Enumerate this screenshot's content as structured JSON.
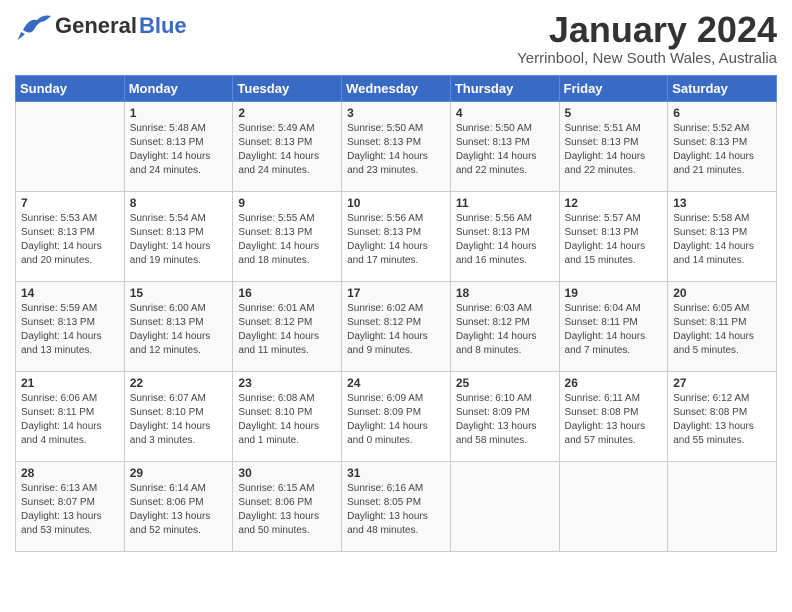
{
  "logo": {
    "text_general": "General",
    "text_blue": "Blue"
  },
  "title": "January 2024",
  "location": "Yerrinbool, New South Wales, Australia",
  "weekdays": [
    "Sunday",
    "Monday",
    "Tuesday",
    "Wednesday",
    "Thursday",
    "Friday",
    "Saturday"
  ],
  "weeks": [
    [
      {
        "day": "",
        "info": ""
      },
      {
        "day": "1",
        "info": "Sunrise: 5:48 AM\nSunset: 8:13 PM\nDaylight: 14 hours\nand 24 minutes."
      },
      {
        "day": "2",
        "info": "Sunrise: 5:49 AM\nSunset: 8:13 PM\nDaylight: 14 hours\nand 24 minutes."
      },
      {
        "day": "3",
        "info": "Sunrise: 5:50 AM\nSunset: 8:13 PM\nDaylight: 14 hours\nand 23 minutes."
      },
      {
        "day": "4",
        "info": "Sunrise: 5:50 AM\nSunset: 8:13 PM\nDaylight: 14 hours\nand 22 minutes."
      },
      {
        "day": "5",
        "info": "Sunrise: 5:51 AM\nSunset: 8:13 PM\nDaylight: 14 hours\nand 22 minutes."
      },
      {
        "day": "6",
        "info": "Sunrise: 5:52 AM\nSunset: 8:13 PM\nDaylight: 14 hours\nand 21 minutes."
      }
    ],
    [
      {
        "day": "7",
        "info": "Sunrise: 5:53 AM\nSunset: 8:13 PM\nDaylight: 14 hours\nand 20 minutes."
      },
      {
        "day": "8",
        "info": "Sunrise: 5:54 AM\nSunset: 8:13 PM\nDaylight: 14 hours\nand 19 minutes."
      },
      {
        "day": "9",
        "info": "Sunrise: 5:55 AM\nSunset: 8:13 PM\nDaylight: 14 hours\nand 18 minutes."
      },
      {
        "day": "10",
        "info": "Sunrise: 5:56 AM\nSunset: 8:13 PM\nDaylight: 14 hours\nand 17 minutes."
      },
      {
        "day": "11",
        "info": "Sunrise: 5:56 AM\nSunset: 8:13 PM\nDaylight: 14 hours\nand 16 minutes."
      },
      {
        "day": "12",
        "info": "Sunrise: 5:57 AM\nSunset: 8:13 PM\nDaylight: 14 hours\nand 15 minutes."
      },
      {
        "day": "13",
        "info": "Sunrise: 5:58 AM\nSunset: 8:13 PM\nDaylight: 14 hours\nand 14 minutes."
      }
    ],
    [
      {
        "day": "14",
        "info": "Sunrise: 5:59 AM\nSunset: 8:13 PM\nDaylight: 14 hours\nand 13 minutes."
      },
      {
        "day": "15",
        "info": "Sunrise: 6:00 AM\nSunset: 8:13 PM\nDaylight: 14 hours\nand 12 minutes."
      },
      {
        "day": "16",
        "info": "Sunrise: 6:01 AM\nSunset: 8:12 PM\nDaylight: 14 hours\nand 11 minutes."
      },
      {
        "day": "17",
        "info": "Sunrise: 6:02 AM\nSunset: 8:12 PM\nDaylight: 14 hours\nand 9 minutes."
      },
      {
        "day": "18",
        "info": "Sunrise: 6:03 AM\nSunset: 8:12 PM\nDaylight: 14 hours\nand 8 minutes."
      },
      {
        "day": "19",
        "info": "Sunrise: 6:04 AM\nSunset: 8:11 PM\nDaylight: 14 hours\nand 7 minutes."
      },
      {
        "day": "20",
        "info": "Sunrise: 6:05 AM\nSunset: 8:11 PM\nDaylight: 14 hours\nand 5 minutes."
      }
    ],
    [
      {
        "day": "21",
        "info": "Sunrise: 6:06 AM\nSunset: 8:11 PM\nDaylight: 14 hours\nand 4 minutes."
      },
      {
        "day": "22",
        "info": "Sunrise: 6:07 AM\nSunset: 8:10 PM\nDaylight: 14 hours\nand 3 minutes."
      },
      {
        "day": "23",
        "info": "Sunrise: 6:08 AM\nSunset: 8:10 PM\nDaylight: 14 hours\nand 1 minute."
      },
      {
        "day": "24",
        "info": "Sunrise: 6:09 AM\nSunset: 8:09 PM\nDaylight: 14 hours\nand 0 minutes."
      },
      {
        "day": "25",
        "info": "Sunrise: 6:10 AM\nSunset: 8:09 PM\nDaylight: 13 hours\nand 58 minutes."
      },
      {
        "day": "26",
        "info": "Sunrise: 6:11 AM\nSunset: 8:08 PM\nDaylight: 13 hours\nand 57 minutes."
      },
      {
        "day": "27",
        "info": "Sunrise: 6:12 AM\nSunset: 8:08 PM\nDaylight: 13 hours\nand 55 minutes."
      }
    ],
    [
      {
        "day": "28",
        "info": "Sunrise: 6:13 AM\nSunset: 8:07 PM\nDaylight: 13 hours\nand 53 minutes."
      },
      {
        "day": "29",
        "info": "Sunrise: 6:14 AM\nSunset: 8:06 PM\nDaylight: 13 hours\nand 52 minutes."
      },
      {
        "day": "30",
        "info": "Sunrise: 6:15 AM\nSunset: 8:06 PM\nDaylight: 13 hours\nand 50 minutes."
      },
      {
        "day": "31",
        "info": "Sunrise: 6:16 AM\nSunset: 8:05 PM\nDaylight: 13 hours\nand 48 minutes."
      },
      {
        "day": "",
        "info": ""
      },
      {
        "day": "",
        "info": ""
      },
      {
        "day": "",
        "info": ""
      }
    ]
  ]
}
